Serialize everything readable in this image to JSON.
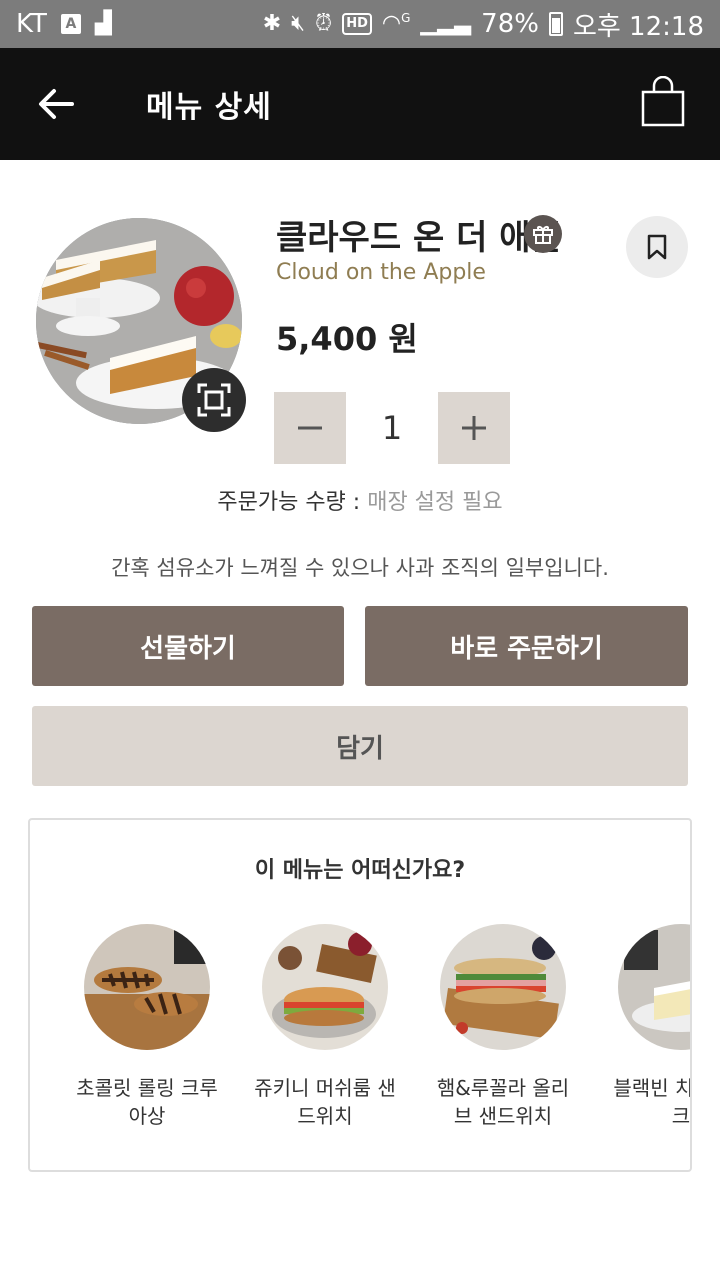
{
  "status_bar": {
    "carrier": "KT",
    "notification_a": "A",
    "network_type": "G",
    "hd_label": "HD",
    "battery": "78%",
    "time": "오후 12:18"
  },
  "header": {
    "title": "메뉴 상세"
  },
  "product": {
    "name": "클라우드 온 더 애플",
    "name_en": "Cloud on the Apple",
    "price": "5,400 원",
    "quantity": "1",
    "order_limit_label": "주문가능 수량 :",
    "order_limit_value": "매장 설정 필요",
    "description": "간혹 섬유소가 느껴질 수 있으나 사과 조직의 일부입니다."
  },
  "actions": {
    "gift": "선물하기",
    "order_now": "바로 주문하기",
    "add_to_cart": "담기"
  },
  "recommend": {
    "title": "이 메뉴는 어떠신가요?",
    "items": [
      {
        "label": "초콜릿 롤링 크루아상"
      },
      {
        "label": "쥬키니 머쉬룸 샌드위치"
      },
      {
        "label": "햄&루꼴라 올리브 샌드위치"
      },
      {
        "label": "블랙빈 치즈케이크"
      }
    ]
  },
  "colors": {
    "header_bg": "#111111",
    "status_bg": "#7c7c7c",
    "primary_button": "#7a6c64",
    "secondary_button": "#dcd6d0",
    "english_name": "#8f7d52"
  }
}
